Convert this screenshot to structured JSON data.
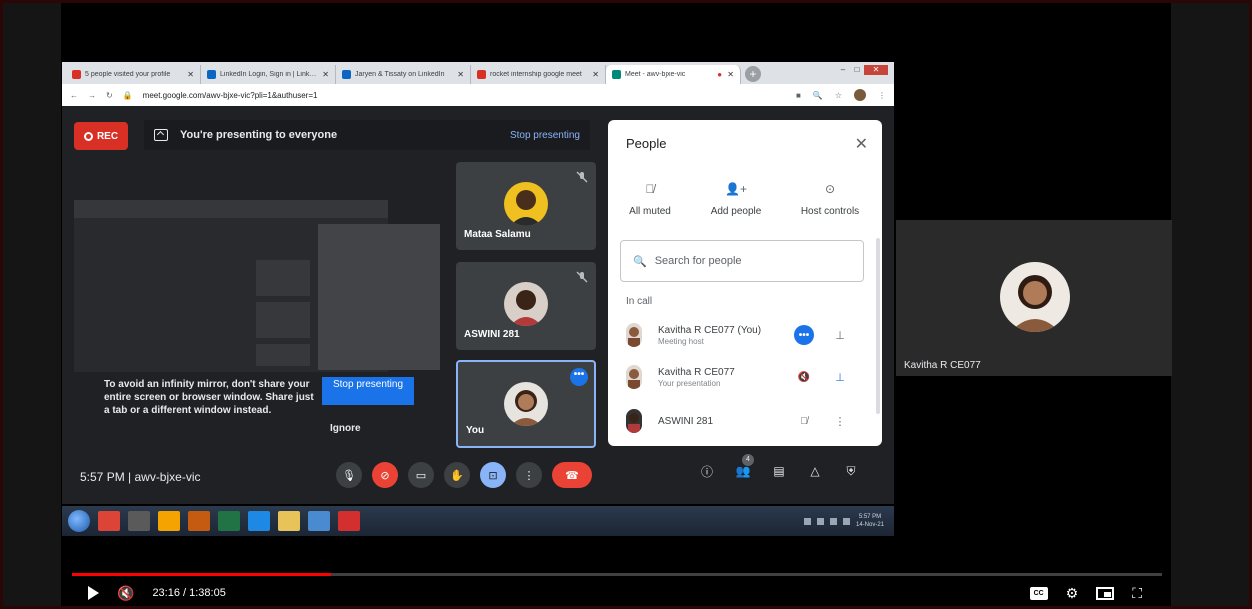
{
  "browser": {
    "tabs": [
      {
        "label": "5 people visited your profile",
        "color": "#d93025"
      },
      {
        "label": "LinkedIn Login, Sign in | Linke...",
        "color": "#0a66c2"
      },
      {
        "label": "Jaryen & Tissaty on LinkedIn",
        "color": "#0a66c2"
      },
      {
        "label": "rocket internship google meet",
        "color": "#d93025"
      },
      {
        "label": "Meet - awv-bjxe-vic",
        "color": "#00897b"
      }
    ],
    "url": "meet.google.com/awv-bjxe-vic?pli=1&authuser=1"
  },
  "meet": {
    "rec_label": "REC",
    "banner_text": "You're presenting to everyone",
    "banner_stop": "Stop presenting",
    "warning_text": "To avoid an infinity mirror, don't share your entire screen or browser window. Share just a tab or a different window instead.",
    "stop_button": "Stop presenting",
    "ignore_button": "Ignore",
    "tiles": [
      {
        "name": "Mataa Salamu"
      },
      {
        "name": "ASWINI 281"
      },
      {
        "name": "You"
      }
    ],
    "time_code": "5:57 PM  |  awv-bjxe-vic",
    "people_count": "4"
  },
  "people": {
    "title": "People",
    "actions": [
      "All muted",
      "Add people",
      "Host controls"
    ],
    "search_placeholder": "Search for people",
    "section": "In call",
    "rows": [
      {
        "name": "Kavitha R CE077 (You)",
        "sub": "Meeting host"
      },
      {
        "name": "Kavitha R CE077",
        "sub": "Your presentation"
      },
      {
        "name": "ASWINI 281",
        "sub": ""
      }
    ]
  },
  "side_participant": {
    "name": "Kavitha R CE077"
  },
  "taskbar": {
    "clock_time": "5:57 PM",
    "clock_date": "14-Nov-21"
  },
  "player": {
    "time": "23:16 / 1:38:05",
    "progress": 0.238
  }
}
